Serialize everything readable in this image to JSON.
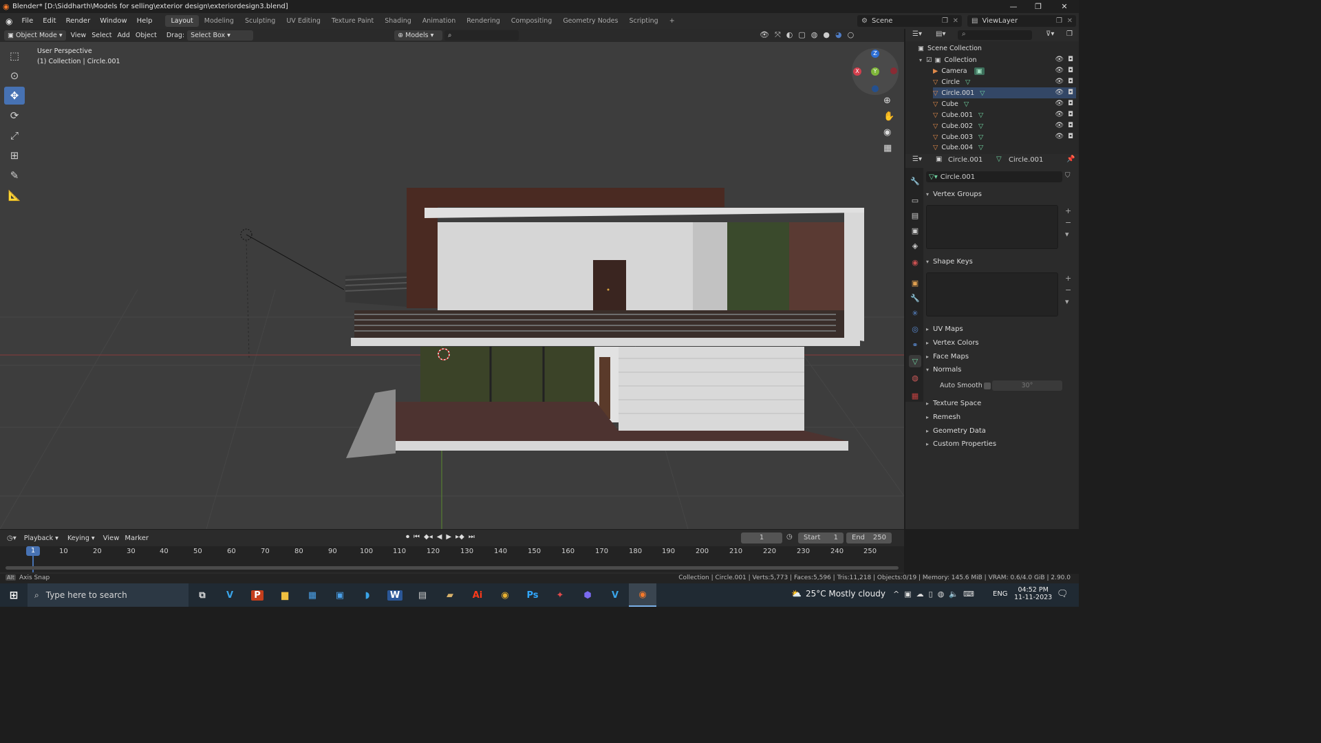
{
  "window": {
    "title": "Blender* [D:\\Siddharth\\Models for selling\\exterior design\\exteriordesign3.blend]"
  },
  "menu": [
    "File",
    "Edit",
    "Render",
    "Window",
    "Help"
  ],
  "workspaces": [
    "Layout",
    "Modeling",
    "Sculpting",
    "UV Editing",
    "Texture Paint",
    "Shading",
    "Animation",
    "Rendering",
    "Compositing",
    "Geometry Nodes",
    "Scripting"
  ],
  "scene": {
    "label": "Scene",
    "view_layer": "ViewLayer"
  },
  "viewport_header": {
    "mode": "Object Mode",
    "view": "View",
    "select": "Select",
    "add": "Add",
    "object": "Object",
    "drag_label": "Drag:",
    "drag_value": "Select Box",
    "orientation": "Models"
  },
  "viewport": {
    "perspective": "User Perspective",
    "collection_info": "(1) Collection | Circle.001"
  },
  "outliner": {
    "root": "Scene Collection",
    "collection": "Collection",
    "items": [
      "Camera",
      "Circle",
      "Circle.001",
      "Cube",
      "Cube.001",
      "Cube.002",
      "Cube.003",
      "Cube.004"
    ]
  },
  "properties": {
    "object_name": "Circle.001",
    "mesh_name": "Circle.001",
    "data_name": "Circle.001",
    "panels_top": [
      "Vertex Groups",
      "Shape Keys"
    ],
    "panels": [
      "UV Maps",
      "Vertex Colors",
      "Face Maps",
      "Normals"
    ],
    "auto_smooth_label": "Auto Smooth",
    "auto_smooth_angle": "30°",
    "panels_bottom": [
      "Texture Space",
      "Remesh",
      "Geometry Data",
      "Custom Properties"
    ]
  },
  "timeline": {
    "menus": [
      "Playback",
      "Keying",
      "View",
      "Marker"
    ],
    "current_frame": "1",
    "start_label": "Start",
    "start": "1",
    "end_label": "End",
    "end": "250",
    "ticks": [
      "1",
      "10",
      "20",
      "30",
      "40",
      "50",
      "60",
      "70",
      "80",
      "90",
      "100",
      "110",
      "120",
      "130",
      "140",
      "150",
      "160",
      "170",
      "180",
      "190",
      "200",
      "210",
      "220",
      "230",
      "240",
      "250"
    ]
  },
  "status": {
    "left": "Axis Snap",
    "right": "Collection | Circle.001 | Verts:5,773 | Faces:5,596 | Tris:11,218 | Objects:0/19 | Memory: 145.6 MiB | VRAM: 0.6/4.0 GiB | 2.90.0"
  },
  "taskbar": {
    "search_placeholder": "Type here to search",
    "weather": "25°C  Mostly cloudy",
    "lang": "ENG",
    "time": "04:52 PM",
    "date": "11-11-2023"
  }
}
